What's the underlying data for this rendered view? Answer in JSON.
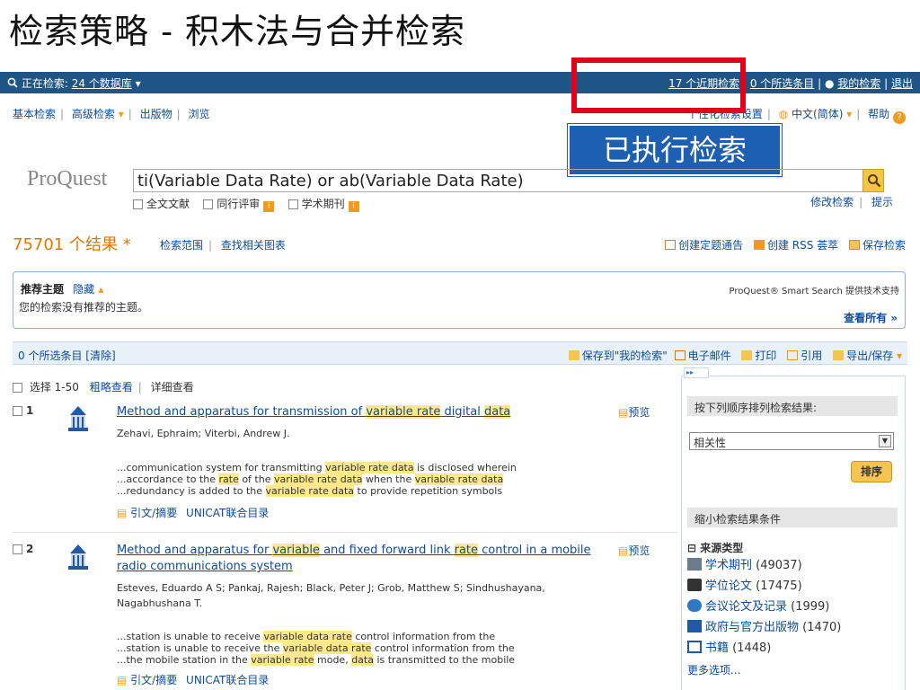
{
  "slide": {
    "title": "检索策略 - 积木法与合并检索",
    "callout": "已执行检索"
  },
  "topbar": {
    "searching_prefix": "正在检索:",
    "databases_link": "24 个数据库",
    "recent_searches": "17 个近期检索",
    "selected_items": "0 个所选条目",
    "my_searches": "我的检索",
    "logout": "退出"
  },
  "nav": {
    "basic": "基本检索",
    "advanced": "高级检索",
    "publications": "出版物",
    "browse": "浏览",
    "personal_settings": "个性化检索设置",
    "language": "中文(简体)",
    "help": "帮助"
  },
  "search": {
    "logo": "ProQuest",
    "query": "ti(Variable Data Rate) or ab(Variable Data Rate)",
    "filters": [
      "全文文献",
      "同行评审",
      "学术期刊"
    ],
    "modify": "修改检索",
    "tips": "提示"
  },
  "results_header": {
    "count": "75701 个结果 *",
    "scope": "检索范围",
    "related_charts": "查找相关图表",
    "alert": "创建定题通告",
    "rss": "创建 RSS 荟萃",
    "save_search": "保存检索"
  },
  "recommend": {
    "title": "推荐主题",
    "hide": "隐藏",
    "message": "您的检索没有推荐的主题。",
    "brand": "ProQuest® Smart Search 提供技术支持",
    "view_all": "查看所有 »"
  },
  "selection_bar": {
    "left": "0 个所选条目 [清除]",
    "save_to_my": "保存到\"我的检索\"",
    "email": "电子邮件",
    "print": "打印",
    "cite": "引用",
    "export": "导出/保存"
  },
  "list_head": {
    "select": "选择 1-50",
    "brief": "粗略查看",
    "detailed": "详细查看"
  },
  "results": [
    {
      "num": "1",
      "title_parts": [
        {
          "t": "Method and apparatus for transmission of ",
          "h": false
        },
        {
          "t": "variable rate",
          "h": true
        },
        {
          "t": " digital ",
          "h": false
        },
        {
          "t": "data",
          "h": true
        }
      ],
      "authors": "Zehavi, Ephraim; Viterbi, Andrew J.",
      "snippets": [
        [
          {
            "t": "...communication system for transmitting ",
            "h": false
          },
          {
            "t": "variable rate data",
            "h": true
          },
          {
            "t": " is disclosed wherein",
            "h": false
          }
        ],
        [
          {
            "t": "...accordance to the ",
            "h": false
          },
          {
            "t": "rate",
            "h": true
          },
          {
            "t": " of the ",
            "h": false
          },
          {
            "t": "variable rate data",
            "h": true
          },
          {
            "t": " when the ",
            "h": false
          },
          {
            "t": "variable rate data",
            "h": true
          }
        ],
        [
          {
            "t": "...redundancy is added to the ",
            "h": false
          },
          {
            "t": "variable rate data",
            "h": true
          },
          {
            "t": " to provide repetition symbols",
            "h": false
          }
        ]
      ],
      "preview": "预览",
      "cite_abstract": "引文/摘要",
      "unicat": "UNICAT联合目录"
    },
    {
      "num": "2",
      "title_parts": [
        {
          "t": "Method and apparatus for ",
          "h": false
        },
        {
          "t": "variable",
          "h": true
        },
        {
          "t": " and fixed forward link ",
          "h": false
        },
        {
          "t": "rate",
          "h": true
        },
        {
          "t": " control in a mobile radio communications system",
          "h": false
        }
      ],
      "authors": "Esteves, Eduardo A S; Pankaj, Rajesh; Black, Peter J; Grob, Matthew S; Sindhushayana, Nagabhushana T.",
      "snippets": [
        [
          {
            "t": "...station is unable to receive ",
            "h": false
          },
          {
            "t": "variable data rate",
            "h": true
          },
          {
            "t": " control information from the",
            "h": false
          }
        ],
        [
          {
            "t": "...station is unable to receive the ",
            "h": false
          },
          {
            "t": "variable data rate",
            "h": true
          },
          {
            "t": " control information from the",
            "h": false
          }
        ],
        [
          {
            "t": "...the mobile station in the ",
            "h": false
          },
          {
            "t": "variable rate",
            "h": true
          },
          {
            "t": " mode, ",
            "h": false
          },
          {
            "t": "data",
            "h": true
          },
          {
            "t": " is transmitted to the mobile",
            "h": false
          }
        ]
      ],
      "preview": "预览",
      "cite_abstract": "引文/摘要",
      "unicat": "UNICAT联合目录"
    }
  ],
  "sidebar": {
    "sort_label": "按下列顺序排列检索结果:",
    "sort_value": "相关性",
    "sort_button": "排序",
    "narrow_label": "缩小检索结果条件",
    "facet_title": "来源类型",
    "facets": [
      {
        "label": "学术期刊",
        "count": "(49037)",
        "icon": "journal-icon"
      },
      {
        "label": "学位论文",
        "count": "(17475)",
        "icon": "graduation-cap-icon"
      },
      {
        "label": "会议论文及记录",
        "count": "(1999)",
        "icon": "conference-icon"
      },
      {
        "label": "政府与官方出版物",
        "count": "(1470)",
        "icon": "government-building-icon"
      },
      {
        "label": "书籍",
        "count": "(1448)",
        "icon": "book-icon"
      }
    ],
    "more": "更多选项..."
  },
  "colors": {
    "topbar": "#1f5586",
    "count": "#e07800",
    "highlight": "#fde98a",
    "callout": "#1d5fb0",
    "red_box": "#e2001a"
  }
}
